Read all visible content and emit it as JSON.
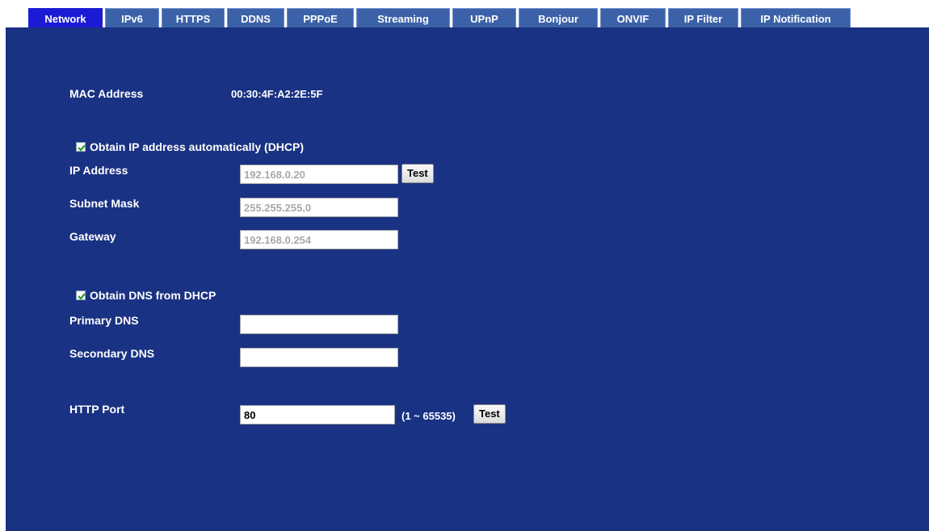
{
  "tabs": [
    {
      "label": "Network",
      "active": true
    },
    {
      "label": "IPv6"
    },
    {
      "label": "HTTPS"
    },
    {
      "label": "DDNS"
    },
    {
      "label": "PPPoE"
    },
    {
      "label": "Streaming"
    },
    {
      "label": "UPnP"
    },
    {
      "label": "Bonjour"
    },
    {
      "label": "ONVIF"
    },
    {
      "label": "IP Filter"
    },
    {
      "label": "IP Notification"
    }
  ],
  "mac": {
    "label": "MAC Address",
    "value": "00:30:4F:A2:2E:5F"
  },
  "dhcp": {
    "label": "Obtain IP address automatically (DHCP)",
    "checked": true
  },
  "ip": {
    "label": "IP Address",
    "value": "192.168.0.20",
    "test_label": "Test"
  },
  "subnet": {
    "label": "Subnet Mask",
    "value": "255.255.255.0"
  },
  "gateway": {
    "label": "Gateway",
    "value": "192.168.0.254"
  },
  "dns_dhcp": {
    "label": "Obtain DNS from DHCP",
    "checked": true
  },
  "primary_dns": {
    "label": "Primary DNS",
    "value": ""
  },
  "secondary_dns": {
    "label": "Secondary DNS",
    "value": ""
  },
  "http_port": {
    "label": "HTTP Port",
    "value": "80",
    "range": "(1 ~ 65535)",
    "test_label": "Test"
  },
  "colors": {
    "panel": "#1a3283",
    "tab": "#3b62a8",
    "tab_active": "#1b1bd6",
    "checkbox_mark": "#2e9a2e"
  }
}
